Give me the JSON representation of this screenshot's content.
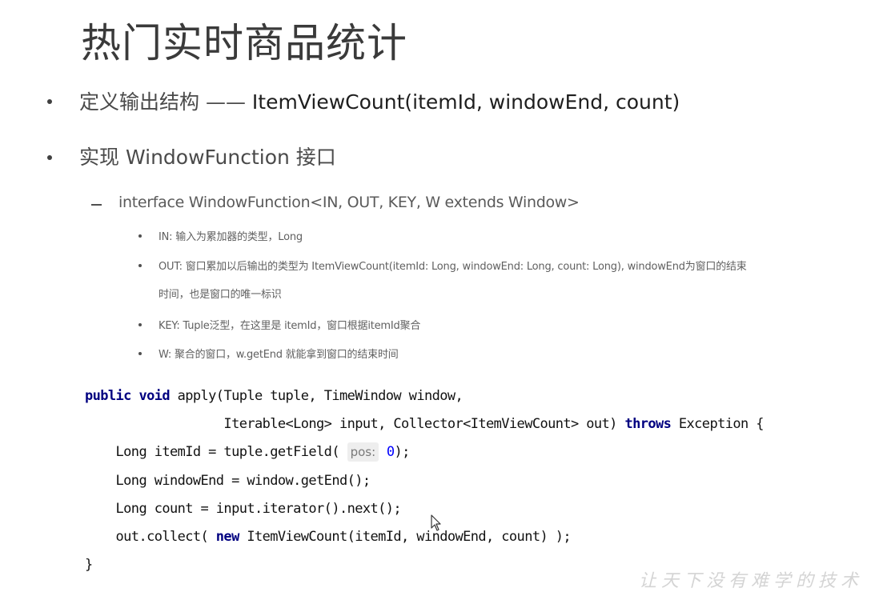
{
  "slide": {
    "title": "热门实时商品统计",
    "bullets": [
      {
        "prefix": "定义输出结构 —— ",
        "emph": "ItemViewCount(itemId, windowEnd, count)"
      },
      {
        "text": "实现 WindowFunction 接口"
      }
    ],
    "sub_bullet": "interface WindowFunction<IN, OUT, KEY, W extends Window>",
    "params": [
      "IN: 输入为累加器的类型，Long",
      "OUT: 窗口累加以后输出的类型为 ItemViewCount(itemId:  Long, windowEnd: Long, count: Long), windowEnd为窗口的结束",
      "时间，也是窗口的唯一标识",
      "KEY: Tuple泛型，在这里是 itemId，窗口根据itemId聚合",
      "W: 聚合的窗口，w.getEnd 就能拿到窗口的结束时间"
    ],
    "watermark": "让天下没有难学的技术"
  },
  "code": {
    "l1_kw1": "public",
    "l1_kw2": "void",
    "l1_rest": " apply(Tuple tuple, TimeWindow window,",
    "l2_pre": "                  Iterable<Long> input, Collector<ItemViewCount> out) ",
    "l2_kw": "throws",
    "l2_post": " Exception {",
    "l3_pre": "    Long itemId = tuple.getField( ",
    "l3_hint": "pos:",
    "l3_num": "0",
    "l3_post": ");",
    "l4": "    Long windowEnd = window.getEnd();",
    "l5": "    Long count = input.iterator().next();",
    "l6_pre": "    out.collect( ",
    "l6_kw": "new",
    "l6_post": " ItemViewCount(itemId, windowEnd, count) );",
    "l7": "}"
  }
}
